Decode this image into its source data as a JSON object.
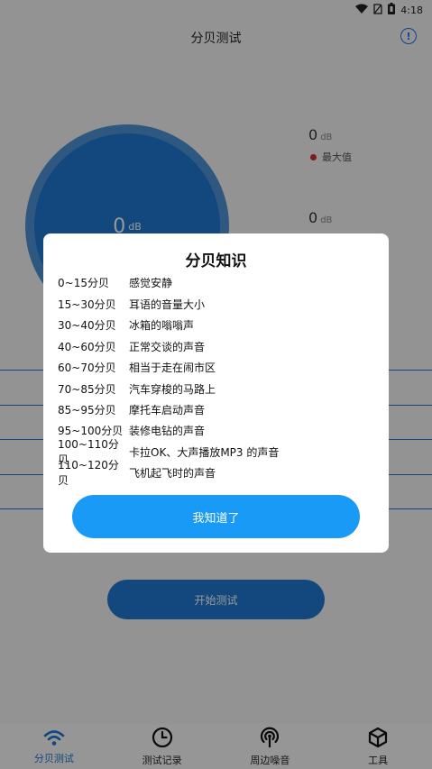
{
  "status_bar": {
    "time": "4:18"
  },
  "header": {
    "title": "分贝测试",
    "info_icon": "info-icon"
  },
  "gauge": {
    "value": "0",
    "unit": "dB"
  },
  "stats": {
    "max": {
      "value": "0",
      "unit": "dB",
      "label": "最大值",
      "color": "#d32f2f"
    },
    "second": {
      "value": "0",
      "unit": "dB"
    }
  },
  "start_button": "开始测试",
  "dialog": {
    "title": "分贝知识",
    "rows": [
      {
        "range": "0~15分贝",
        "desc": "感觉安静"
      },
      {
        "range": "15~30分贝",
        "desc": "耳语的音量大小"
      },
      {
        "range": "30~40分贝",
        "desc": "冰箱的嗡嗡声"
      },
      {
        "range": "40~60分贝",
        "desc": "正常交谈的声音"
      },
      {
        "range": "60~70分贝",
        "desc": "相当于走在闹市区"
      },
      {
        "range": "70~85分贝",
        "desc": "汽车穿梭的马路上"
      },
      {
        "range": "85~95分贝",
        "desc": "摩托车启动声音"
      },
      {
        "range": "95~100分贝",
        "desc": "装修电钻的声音"
      },
      {
        "range": "100~110分贝",
        "desc": "卡拉OK、大声播放MP3 的声音"
      },
      {
        "range": "110~120分贝",
        "desc": "飞机起飞时的声音"
      }
    ],
    "ok_button": "我知道了"
  },
  "nav": [
    {
      "label": "分贝测试",
      "icon": "wifi-icon",
      "active": true
    },
    {
      "label": "测试记录",
      "icon": "clock-icon",
      "active": false
    },
    {
      "label": "周边噪音",
      "icon": "broadcast-icon",
      "active": false
    },
    {
      "label": "工具",
      "icon": "cube-icon",
      "active": false
    }
  ],
  "colors": {
    "accent": "#1f78d1",
    "dialog_button": "#1a9af7"
  }
}
